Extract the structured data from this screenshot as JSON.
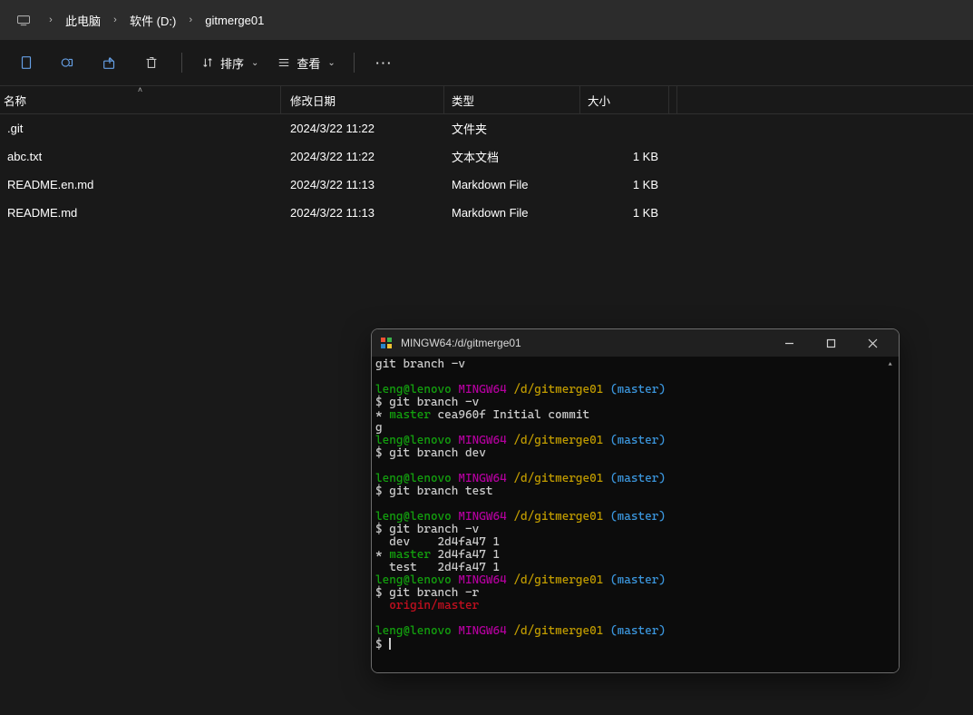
{
  "breadcrumb": {
    "items": [
      "此电脑",
      "软件 (D:)",
      "gitmerge01"
    ]
  },
  "toolbar": {
    "sort_label": "排序",
    "view_label": "查看"
  },
  "columns": {
    "name": "名称",
    "date": "修改日期",
    "type": "类型",
    "size": "大小"
  },
  "files": [
    {
      "name": ".git",
      "date": "2024/3/22 11:22",
      "type": "文件夹",
      "size": ""
    },
    {
      "name": "abc.txt",
      "date": "2024/3/22 11:22",
      "type": "文本文档",
      "size": "1 KB"
    },
    {
      "name": "README.en.md",
      "date": "2024/3/22 11:13",
      "type": "Markdown File",
      "size": "1 KB"
    },
    {
      "name": "README.md",
      "date": "2024/3/22 11:13",
      "type": "Markdown File",
      "size": "1 KB"
    }
  ],
  "terminal": {
    "title": "MINGW64:/d/gitmerge01",
    "user": "leng@lenovo",
    "host": "MINGW64",
    "path": "/d/gitmerge01",
    "branch": "(master)",
    "lines": {
      "l0": "git branch -v",
      "l2": "$ git branch -v",
      "l3a": "* ",
      "l3b": "master",
      "l3c": " cea960f Initial commit",
      "l4": "g",
      "l6": "$ git branch dev",
      "l8": "$ git branch test",
      "l10": "$ git branch -v",
      "l11": "  dev    2d4fa47 1",
      "l12a": "* ",
      "l12b": "master",
      "l12c": " 2d4fa47 1",
      "l13": "  test   2d4fa47 1",
      "l15": "$ git branch -r",
      "l16": "  origin/master",
      "l18": "$ "
    }
  }
}
